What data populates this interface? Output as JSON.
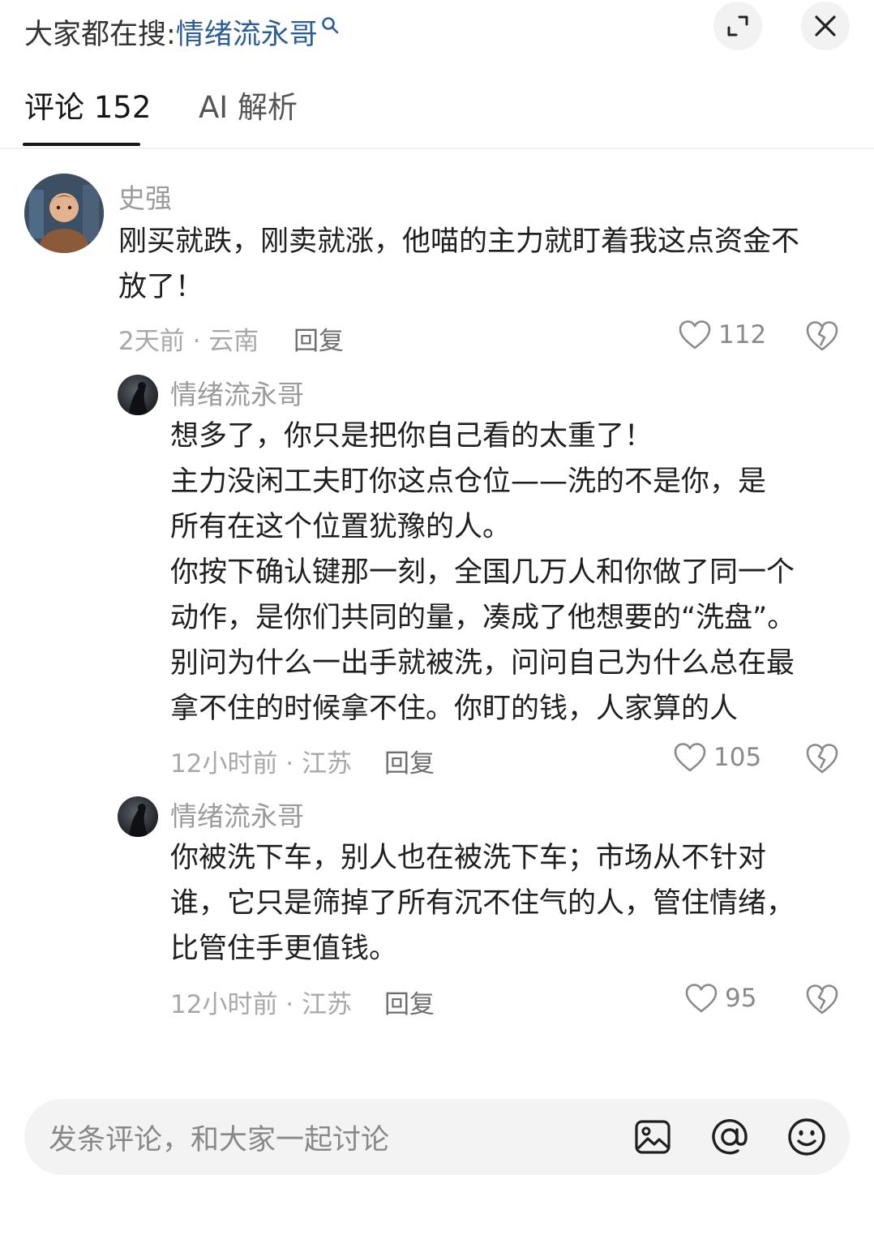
{
  "header": {
    "search_prefix": "大家都在搜:",
    "search_keyword": "情绪流永哥"
  },
  "tabs": [
    {
      "label": "评论 152",
      "active": true
    },
    {
      "label": "AI 解析",
      "active": false
    }
  ],
  "comments": [
    {
      "username": "史强",
      "lines": [
        "刚买就跌，刚卖就涨，他喵的主力就盯着我这点资金不",
        "放了！"
      ],
      "meta": "2天前 · 云南",
      "reply_label": "回复",
      "likes": "112"
    },
    {
      "username": "情绪流永哥",
      "lines": [
        "想多了，你只是把你自己看的太重了！",
        "主力没闲工夫盯你这点仓位——洗的不是你，是",
        "所有在这个位置犹豫的人。",
        "你按下确认键那一刻，全国几万人和你做了同一个",
        "动作，是你们共同的量，凑成了他想要的“洗盘”。",
        "别问为什么一出手就被洗，问问自己为什么总在最",
        "拿不住的时候拿不住。你盯的钱，人家算的人"
      ],
      "meta": "12小时前 · 江苏",
      "reply_label": "回复",
      "likes": "105"
    },
    {
      "username": "情绪流永哥",
      "lines": [
        "你被洗下车，别人也在被洗下车；市场从不针对",
        "谁，它只是筛掉了所有沉不住气的人，管住情绪，",
        "比管住手更值钱。"
      ],
      "meta": "12小时前 · 江苏",
      "reply_label": "回复",
      "likes": "95"
    }
  ],
  "composer": {
    "placeholder": "发条评论，和大家一起讨论"
  },
  "icons": {
    "search": "search-icon",
    "expand": "expand-icon",
    "close": "close-icon",
    "like": "heart-icon",
    "dislike": "broken-heart-icon",
    "image": "image-icon",
    "mention": "at-icon",
    "emoji": "emoji-icon"
  },
  "colors": {
    "keyword": "#2b5e97",
    "text": "#1f1f1f",
    "muted": "#9b9b9b"
  }
}
